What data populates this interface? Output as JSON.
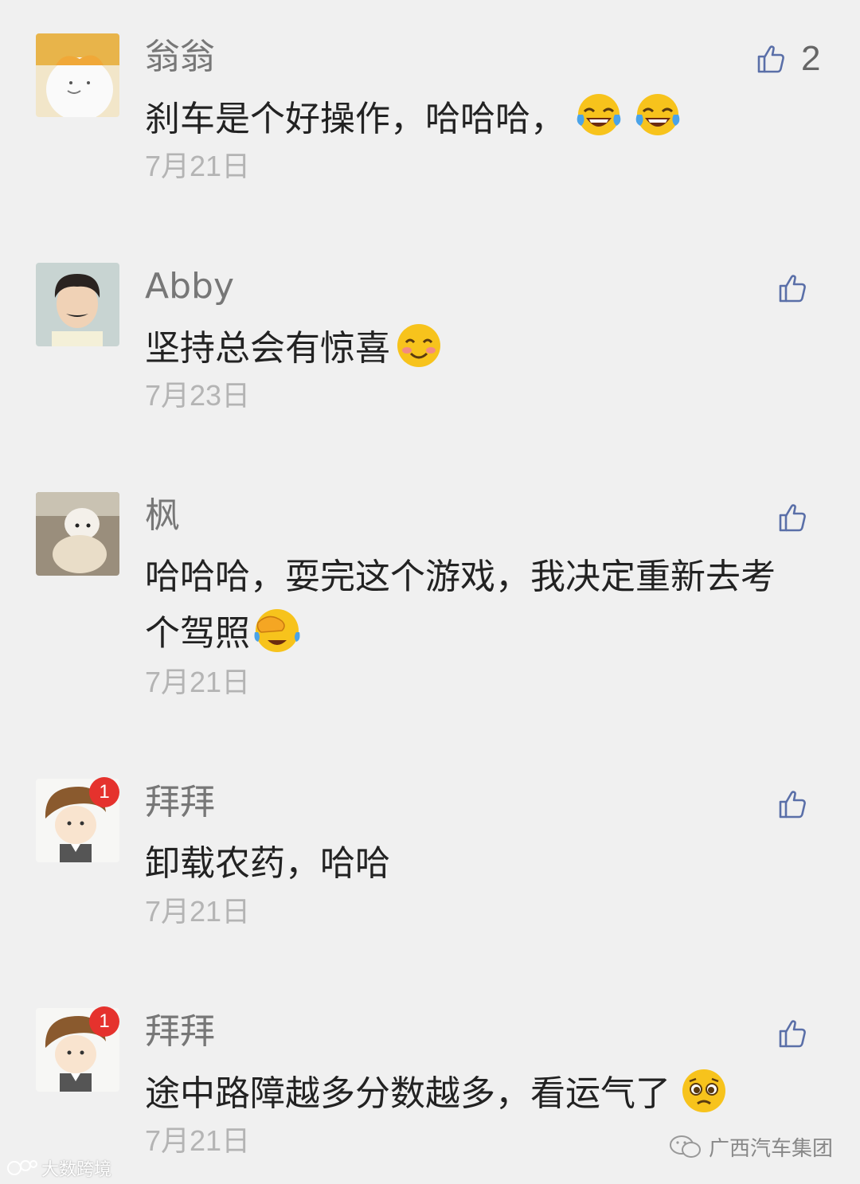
{
  "comments": [
    {
      "name": "翁翁",
      "content": "刹车是个好操作，哈哈哈，",
      "emojis": [
        "joy-emoji",
        "joy-emoji"
      ],
      "date": "7月21日",
      "likes": "2"
    },
    {
      "name": "Abby",
      "content": "坚持总会有惊喜",
      "emojis": [
        "blush-emoji"
      ],
      "date": "7月23日",
      "likes": ""
    },
    {
      "name": "枫",
      "content": "哈哈哈，耍完这个游戏，我决定重新去考个驾照",
      "emojis": [
        "facepalm-emoji"
      ],
      "date": "7月21日",
      "likes": ""
    },
    {
      "name": "拜拜",
      "content": "卸载农药，哈哈",
      "emojis": [],
      "date": "7月21日",
      "likes": "",
      "badge": "1"
    },
    {
      "name": "拜拜",
      "content": "途中路障越多分数越多，看运气了",
      "emojis": [
        "pleading-emoji"
      ],
      "date": "7月21日",
      "likes": "",
      "badge": "1"
    }
  ],
  "watermark_left": "大数跨境",
  "watermark_right": "广西汽车集团",
  "colors": {
    "background": "#f0f0f0",
    "like_icon": "#5a6fa8",
    "badge": "#e5322d"
  }
}
